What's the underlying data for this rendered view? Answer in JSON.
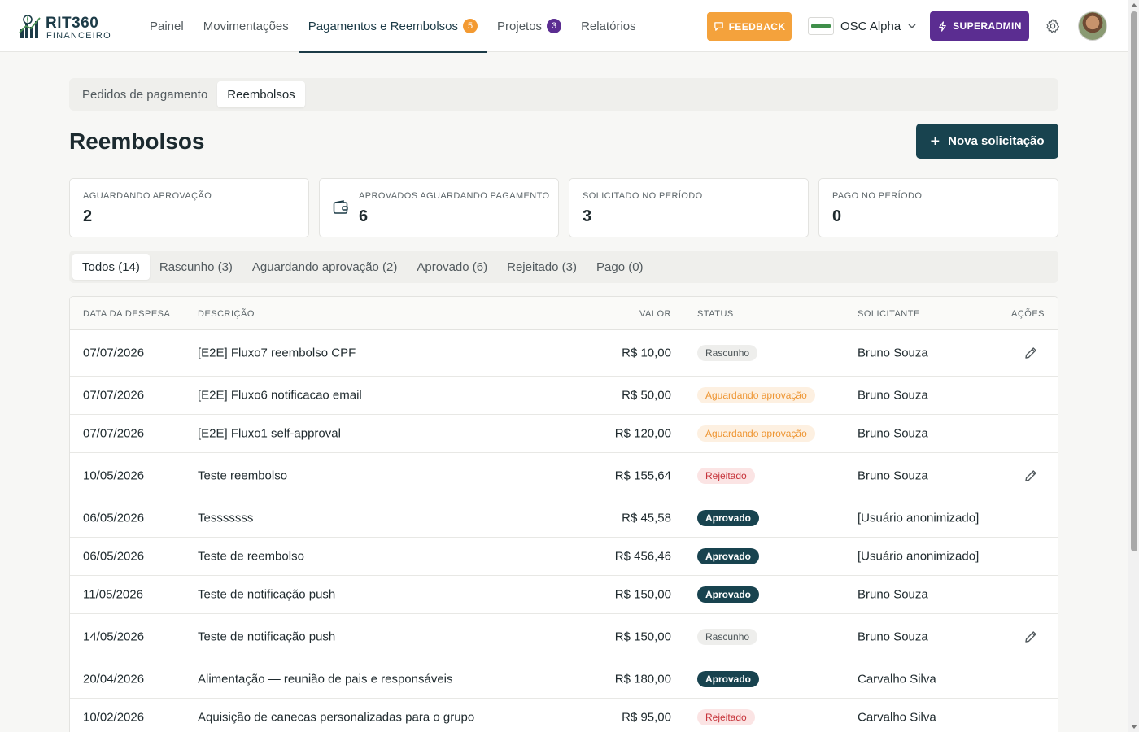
{
  "brand": {
    "name": "RIT360",
    "sub": "FINANCEIRO"
  },
  "nav": [
    {
      "label": "Painel",
      "badge": null
    },
    {
      "label": "Movimentações",
      "badge": null
    },
    {
      "label": "Pagamentos e Reembolsos",
      "badge": "5"
    },
    {
      "label": "Projetos",
      "badge": "3"
    },
    {
      "label": "Relatórios",
      "badge": null
    }
  ],
  "header": {
    "feedback_label": "FEEDBACK",
    "org_name": "OSC Alpha",
    "superadmin_label": "SUPERADMIN"
  },
  "subtabs": [
    "Pedidos de pagamento",
    "Reembolsos"
  ],
  "page": {
    "title": "Reembolsos",
    "new_button": "Nova solicitação"
  },
  "stats": [
    {
      "label": "AGUARDANDO APROVAÇÃO",
      "value": "2"
    },
    {
      "label": "APROVADOS AGUARDANDO PAGAMENTO",
      "value": "6"
    },
    {
      "label": "SOLICITADO NO PERÍODO",
      "value": "3"
    },
    {
      "label": "PAGO NO PERÍODO",
      "value": "0"
    }
  ],
  "filters": [
    "Todos (14)",
    "Rascunho (3)",
    "Aguardando aprovação (2)",
    "Aprovado (6)",
    "Rejeitado (3)",
    "Pago (0)"
  ],
  "table": {
    "headers": {
      "date": "DATA DA DESPESA",
      "desc": "DESCRIÇÃO",
      "value": "VALOR",
      "status": "STATUS",
      "requester": "SOLICITANTE",
      "actions": "AÇÕES"
    },
    "rows": [
      {
        "date": "07/07/2026",
        "desc": "[E2E] Fluxo7 reembolso CPF",
        "value": "R$ 10,00",
        "status": "Rascunho",
        "requester": "Bruno Souza"
      },
      {
        "date": "07/07/2026",
        "desc": "[E2E] Fluxo6 notificacao email",
        "value": "R$ 50,00",
        "status": "Aguardando aprovação",
        "requester": "Bruno Souza"
      },
      {
        "date": "07/07/2026",
        "desc": "[E2E] Fluxo1 self-approval",
        "value": "R$ 120,00",
        "status": "Aguardando aprovação",
        "requester": "Bruno Souza"
      },
      {
        "date": "10/05/2026",
        "desc": "Teste reembolso",
        "value": "R$ 155,64",
        "status": "Rejeitado",
        "requester": "Bruno Souza"
      },
      {
        "date": "06/05/2026",
        "desc": "Tesssssss",
        "value": "R$ 45,58",
        "status": "Aprovado",
        "requester": "[Usuário anonimizado]"
      },
      {
        "date": "06/05/2026",
        "desc": "Teste de reembolso",
        "value": "R$ 456,46",
        "status": "Aprovado",
        "requester": "[Usuário anonimizado]"
      },
      {
        "date": "11/05/2026",
        "desc": "Teste de notificação push",
        "value": "R$ 150,00",
        "status": "Aprovado",
        "requester": "Bruno Souza"
      },
      {
        "date": "14/05/2026",
        "desc": "Teste de notificação push",
        "value": "R$ 150,00",
        "status": "Rascunho",
        "requester": "Bruno Souza"
      },
      {
        "date": "20/04/2026",
        "desc": "Alimentação — reunião de pais e responsáveis",
        "value": "R$ 180,00",
        "status": "Aprovado",
        "requester": "Carvalho Silva"
      },
      {
        "date": "10/02/2026",
        "desc": "Aquisição de canecas personalizadas para o grupo",
        "value": "R$ 95,00",
        "status": "Rejeitado",
        "requester": "Carvalho Silva"
      }
    ]
  },
  "colors": {
    "primary": "#18434f",
    "feedback": "#f4a23c",
    "superadmin": "#5b2d91",
    "status_pending": "#ee9532",
    "status_rejected": "#c6333a"
  }
}
